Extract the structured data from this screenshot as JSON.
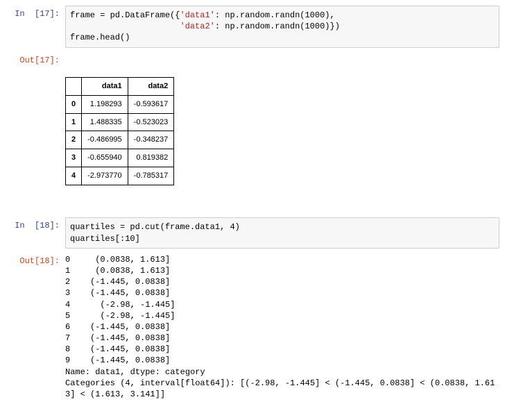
{
  "cells": {
    "in17_prompt": "In  [17]:",
    "out17_prompt": "Out[17]:",
    "in18_prompt": "In  [18]:",
    "out18_prompt": "Out[18]:"
  },
  "code17": {
    "p1a": "frame = pd.DataFrame({",
    "p1s1": "'data1'",
    "p1b": ": np.random.randn(1000),",
    "p2pad": "                      ",
    "p2s1": "'data2'",
    "p2b": ": np.random.randn(1000)})",
    "p3": "frame.head()"
  },
  "table17": {
    "headers": {
      "blank": "",
      "c1": "data1",
      "c2": "data2"
    },
    "rows": [
      {
        "idx": "0",
        "c1": "1.198293",
        "c2": "-0.593617"
      },
      {
        "idx": "1",
        "c1": "1.488335",
        "c2": "-0.523023"
      },
      {
        "idx": "2",
        "c1": "-0.486995",
        "c2": "-0.348237"
      },
      {
        "idx": "3",
        "c1": "-0.655940",
        "c2": "0.819382"
      },
      {
        "idx": "4",
        "c1": "-2.973770",
        "c2": "-0.785317"
      }
    ]
  },
  "code18": {
    "p1": "quartiles = pd.cut(frame.data1, 4)",
    "p2": "quartiles[:10]"
  },
  "out18_text": "0     (0.0838, 1.613]\n1     (0.0838, 1.613]\n2    (-1.445, 0.0838]\n3    (-1.445, 0.0838]\n4      (-2.98, -1.445]\n5      (-2.98, -1.445]\n6    (-1.445, 0.0838]\n7    (-1.445, 0.0838]\n8    (-1.445, 0.0838]\n9    (-1.445, 0.0838]\nName: data1, dtype: category\nCategories (4, interval[float64]): [(-2.98, -1.445] < (-1.445, 0.0838] < (0.0838, 1.61\n3] < (1.613, 3.141]]"
}
